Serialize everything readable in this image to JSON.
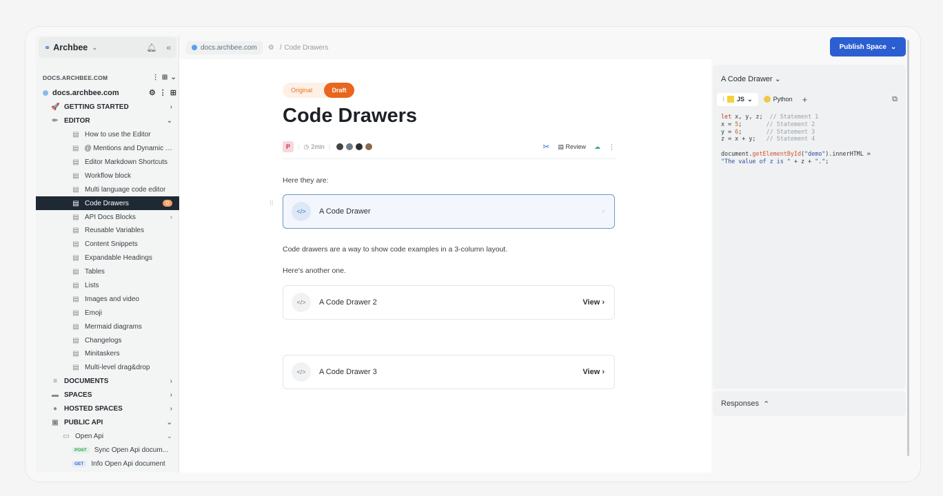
{
  "sidebar": {
    "brand": "Archbee",
    "workspace_label": "DOCS.ARCHBEE.COM",
    "site_name": "docs.archbee.com",
    "items": [
      {
        "label": "GETTING STARTED",
        "level": 0,
        "icon": "🚀",
        "trail": "›"
      },
      {
        "label": "EDITOR",
        "level": 0,
        "icon": "✏",
        "trail": "⌄"
      },
      {
        "label": "How to use the Editor",
        "level": 2,
        "icon": "▤"
      },
      {
        "label": "@ Mentions and Dynamic Li...",
        "level": 2,
        "icon": "▤"
      },
      {
        "label": "Editor Markdown Shortcuts",
        "level": 2,
        "icon": "▤"
      },
      {
        "label": "Workflow block",
        "level": 2,
        "icon": "▤"
      },
      {
        "label": "Multi language code editor",
        "level": 2,
        "icon": "▤"
      },
      {
        "label": "Code Drawers",
        "level": 2,
        "icon": "▤",
        "active": true,
        "badge": "D"
      },
      {
        "label": "API Docs Blocks",
        "level": 2,
        "icon": "▤",
        "trail": "›"
      },
      {
        "label": "Reusable Variables",
        "level": 2,
        "icon": "▤"
      },
      {
        "label": "Content Snippets",
        "level": 2,
        "icon": "▤"
      },
      {
        "label": "Expandable Headings",
        "level": 2,
        "icon": "▤"
      },
      {
        "label": "Tables",
        "level": 2,
        "icon": "▤"
      },
      {
        "label": "Lists",
        "level": 2,
        "icon": "▤"
      },
      {
        "label": "Images and video",
        "level": 2,
        "icon": "▤"
      },
      {
        "label": "Emoji",
        "level": 2,
        "icon": "▤"
      },
      {
        "label": "Mermaid diagrams",
        "level": 2,
        "icon": "▤"
      },
      {
        "label": "Changelogs",
        "level": 2,
        "icon": "▤"
      },
      {
        "label": "Minitaskers",
        "level": 2,
        "icon": "▤"
      },
      {
        "label": "Multi-level drag&drop",
        "level": 2,
        "icon": "▤"
      },
      {
        "label": "DOCUMENTS",
        "level": 0,
        "icon": "≡",
        "trail": "›"
      },
      {
        "label": "SPACES",
        "level": 0,
        "icon": "▬",
        "trail": "›"
      },
      {
        "label": "HOSTED SPACES",
        "level": 0,
        "icon": "●",
        "trail": "›"
      },
      {
        "label": "PUBLIC API",
        "level": 0,
        "icon": "▣",
        "trail": "⌄"
      },
      {
        "label": "Open Api",
        "level": 1,
        "icon": "▭",
        "trail": "⌄"
      },
      {
        "label": "Sync Open Api docum...",
        "level": 2,
        "method": "POST"
      },
      {
        "label": "Info Open Api document",
        "level": 2,
        "method": "GET"
      }
    ]
  },
  "topbar": {
    "site": "docs.archbee.com",
    "separator": "/",
    "crumb": "Code Drawers",
    "publish_label": "Publish Space"
  },
  "doc": {
    "status_original": "Original",
    "status_draft": "Draft",
    "title": "Code Drawers",
    "author_initial": "P",
    "read_time": "2min",
    "review_label": "Review",
    "intro": "Here they are:",
    "para1": "Code drawers are a way to show code examples in a 3-column layout.",
    "para2": "Here's another one.",
    "drawers": [
      {
        "title": "A Code Drawer",
        "action": ""
      },
      {
        "title": "A Code Drawer 2",
        "action": "View"
      },
      {
        "title": "A Code Drawer 3",
        "action": "View"
      }
    ]
  },
  "code_panel": {
    "title": "A Code Drawer",
    "tabs": [
      "JS",
      "Python"
    ],
    "responses_label": "Responses"
  },
  "colors": {
    "active_nav": "#1f2933",
    "publish_button": "#2b5ed1",
    "draft_badge": "#e8661e"
  }
}
